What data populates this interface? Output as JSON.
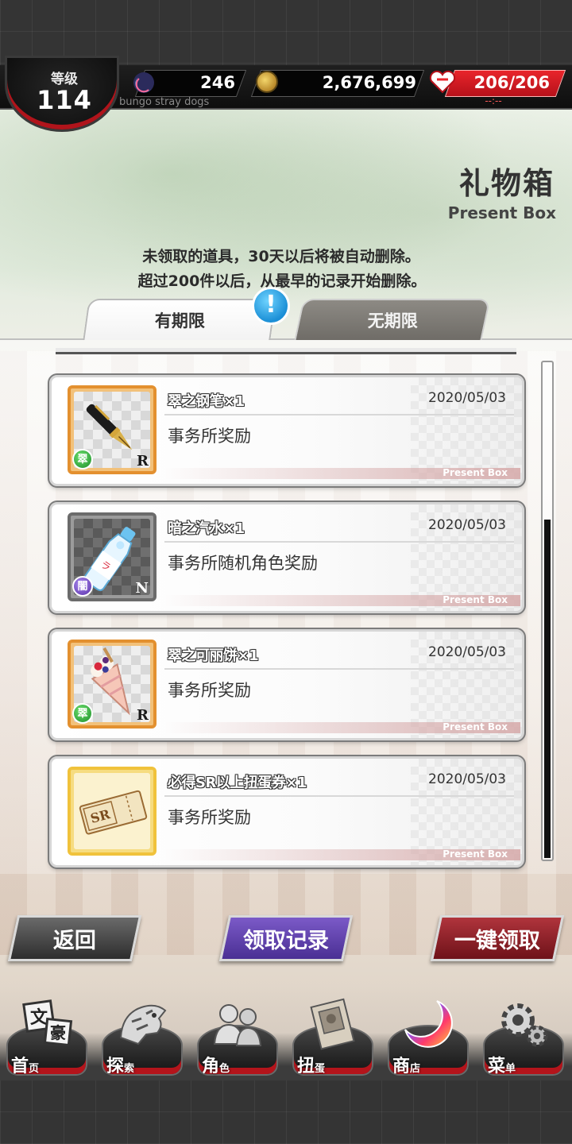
{
  "header": {
    "level_label": "等级",
    "level_value": "114",
    "subtitle": "bungo stray dogs",
    "moonstones": "246",
    "coins": "2,676,699",
    "stamina": "206/206",
    "stamina_timer": "--:--"
  },
  "page": {
    "title": "礼物箱",
    "subtitle": "Present Box",
    "notice_line1": "未领取的道具，30天以后将被自动删除。",
    "notice_line2": "超过200件以后，从最早的记录开始删除。"
  },
  "tabs": {
    "limited": "有期限",
    "unlimited": "无期限",
    "alert": "!"
  },
  "items": [
    {
      "name": "翠之钢笔×1",
      "date": "2020/05/03",
      "desc": "事务所奖励",
      "rarity": "R",
      "attr": "翠",
      "tag": "Present Box",
      "icon": "fountain-pen-icon"
    },
    {
      "name": "暗之汽水×1",
      "date": "2020/05/03",
      "desc": "事务所随机角色奖励",
      "rarity": "N",
      "attr": "闇",
      "tag": "Present Box",
      "icon": "ramune-bottle-icon"
    },
    {
      "name": "翠之可丽饼×1",
      "date": "2020/05/03",
      "desc": "事务所奖励",
      "rarity": "R",
      "attr": "翠",
      "tag": "Present Box",
      "icon": "crepe-icon"
    },
    {
      "name": "必得SR以上扭蛋券×1",
      "date": "2020/05/03",
      "desc": "事务所奖励",
      "rarity": "",
      "attr": "",
      "tag": "Present Box",
      "icon": "sr-ticket-icon"
    }
  ],
  "buttons": {
    "back": "返回",
    "history": "领取记录",
    "claim_all": "一键领取"
  },
  "nav": [
    {
      "big": "首",
      "small": "页",
      "icon": "home-icon"
    },
    {
      "big": "探",
      "small": "索",
      "icon": "explore-tiger-icon"
    },
    {
      "big": "角",
      "small": "色",
      "icon": "characters-icon"
    },
    {
      "big": "扭",
      "small": "蛋",
      "icon": "gacha-book-icon"
    },
    {
      "big": "商",
      "small": "店",
      "icon": "shop-moon-icon"
    },
    {
      "big": "菜",
      "small": "单",
      "icon": "menu-gear-icon"
    }
  ],
  "colors": {
    "accent_red": "#e9252b",
    "rarity_r_frame": "#e3902f",
    "rarity_n_frame": "#6b6b6b",
    "rarity_sr_frame": "#f0c23b",
    "history_button": "#5a3aa8",
    "claim_button": "#8a1c24"
  }
}
